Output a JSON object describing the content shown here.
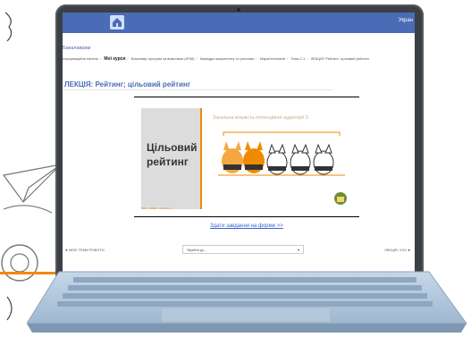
{
  "browser": {
    "language_label": "Укран"
  },
  "course": {
    "section_label": "Бакалаврам",
    "breadcrumb": [
      "Інформаційна панель",
      "Мої курси",
      "Бакалавр програм за вимогами (КПМ)",
      "Кафедра маркетингу та реклами",
      "Маркетинговий",
      "Тема 2.1",
      "ЛЕКЦІЯ: Рейтинг; цільовий рейтинг"
    ]
  },
  "page": {
    "title": "ЛЕКЦІЯ: Рейтинг; цільовий рейтинг"
  },
  "slide": {
    "left_title": "Цільовий\nрейтинг",
    "heading": "Загальна кількість потенційної аудиторії 3",
    "footer_text": "ВНЗ · ФМЕВ · 2024 фото"
  },
  "actions": {
    "form_link": "Здати завдання на форми >>",
    "prev_label": "◄ МОЄ ТЕМИ РОБОТИ",
    "next_label": "ЛЕКЦІЯ: ХХХ ►",
    "jump_select_value": "Перейти до..."
  },
  "colors": {
    "accent_orange": "#f08a00",
    "topbar_blue": "#4a6bb5",
    "laptop_base": "#a9c2db"
  }
}
